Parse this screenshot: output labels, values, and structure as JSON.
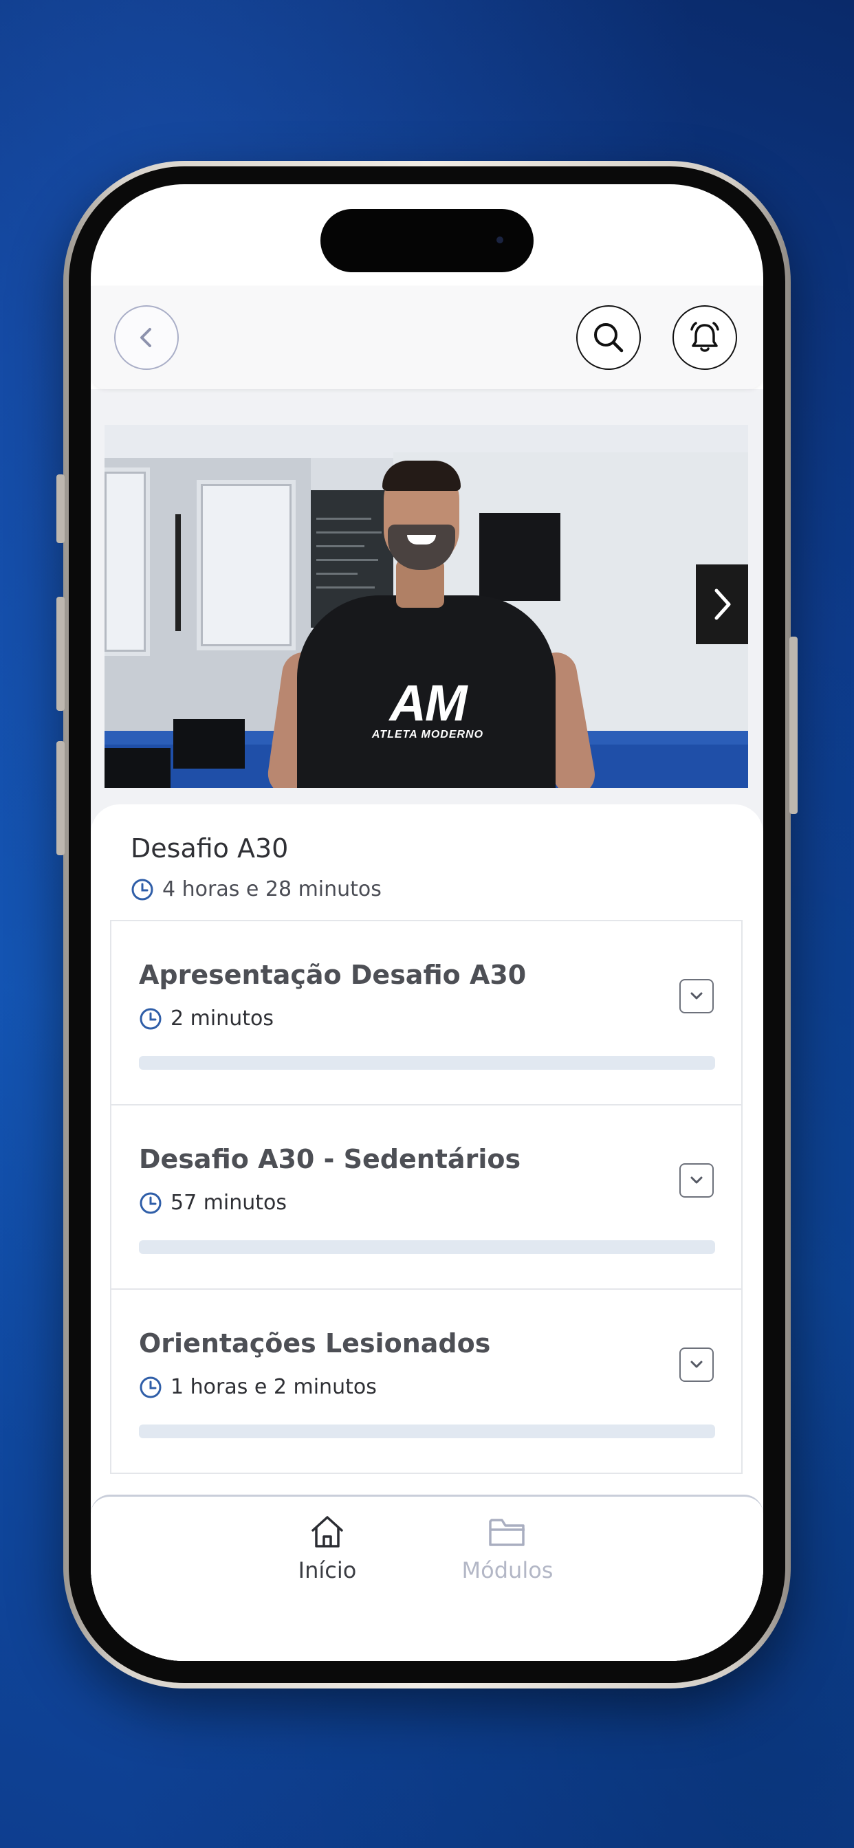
{
  "header": {
    "back_icon": "chevron-left-icon",
    "search_icon": "search-icon",
    "notifications_icon": "bell-icon"
  },
  "video": {
    "shirt_logo_big": "AM",
    "shirt_logo_small": "ATLETA MODERNO",
    "next_icon": "chevron-right-icon"
  },
  "course": {
    "title": "Desafio A30",
    "duration": "4 horas e 28 minutos"
  },
  "modules": [
    {
      "title": "Apresentação Desafio A30",
      "duration": "2 minutos",
      "progress": 0
    },
    {
      "title": "Desafio A30 - Sedentários",
      "duration": "57 minutos",
      "progress": 0
    },
    {
      "title": "Orientações Lesionados",
      "duration": "1 horas e 2 minutos",
      "progress": 0
    }
  ],
  "bottom_nav": {
    "home_label": "Início",
    "modules_label": "Módulos",
    "active": "home"
  },
  "colors": {
    "background": "#1151ad",
    "clock_icon": "#2f5ea8",
    "progress_track": "#e1e8f1",
    "nav_inactive": "#b3b7c6"
  }
}
